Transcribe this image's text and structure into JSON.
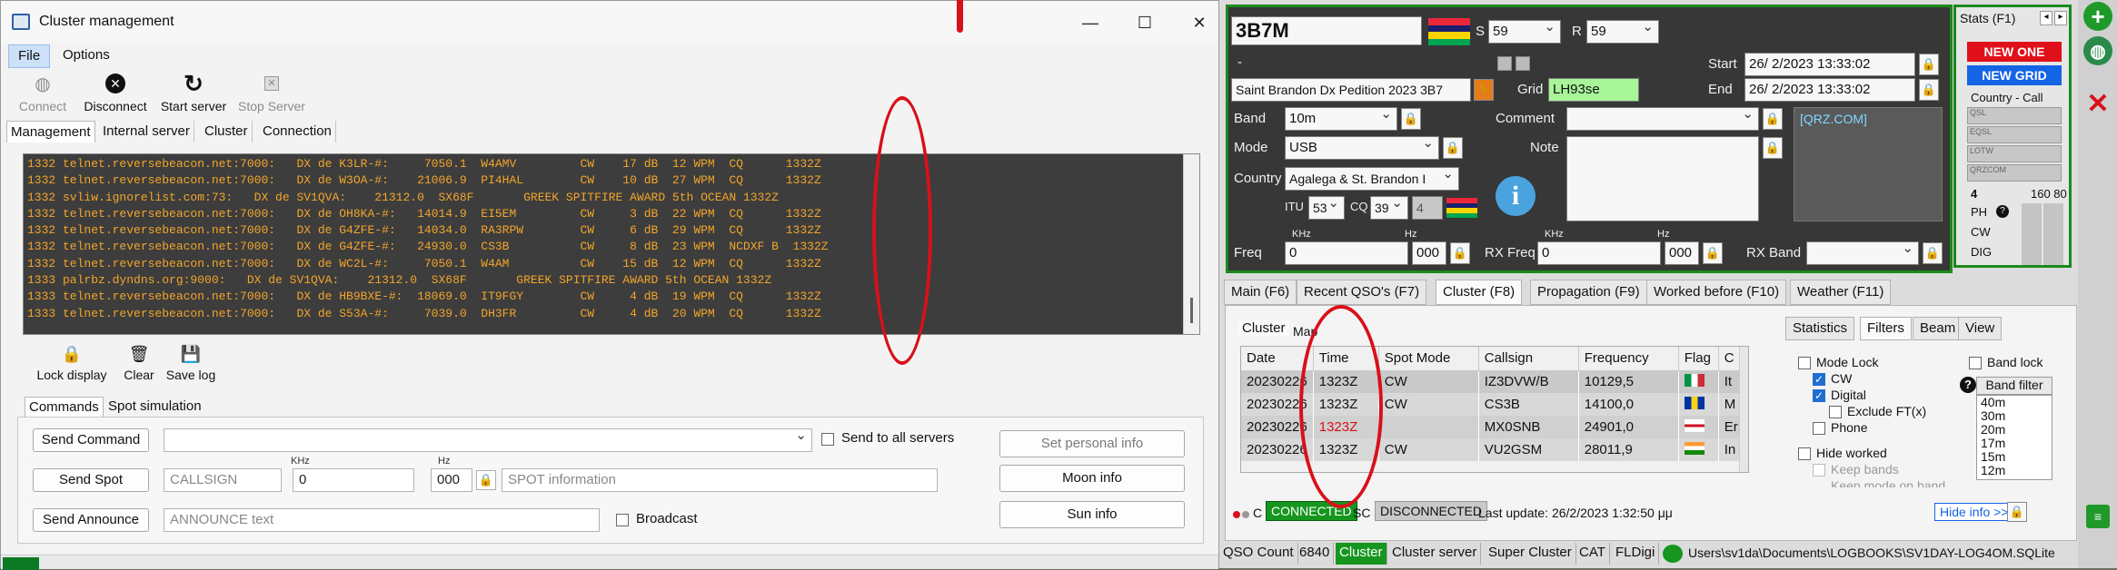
{
  "left_window": {
    "title": "Cluster management",
    "menu": [
      "File",
      "Options"
    ],
    "toolbar": {
      "connect": "Connect",
      "disconnect": "Disconnect",
      "start_server": "Start server",
      "stop_server": "Stop Server"
    },
    "tabs": [
      "Management",
      "Internal server",
      "Cluster",
      "Connection"
    ],
    "console_lines": [
      "1332 telnet.reversebeacon.net:7000:   DX de K3LR-#:     7050.1  W4AMV         CW    17 dB  12 WPM  CQ      1332Z",
      "1332 telnet.reversebeacon.net:7000:   DX de W3OA-#:    21006.9  PI4HAL        CW    10 dB  27 WPM  CQ      1332Z",
      "1332 svliw.ignorelist.com:73:   DX de SV1QVA:    21312.0  SX68F       GREEK SPITFIRE AWARD 5th OCEAN 1332Z",
      "1332 telnet.reversebeacon.net:7000:   DX de OH8KA-#:   14014.9  EI5EM         CW     3 dB  22 WPM  CQ      1332Z",
      "1332 telnet.reversebeacon.net:7000:   DX de G4ZFE-#:   14034.0  RA3RPW        CW     6 dB  29 WPM  CQ      1332Z",
      "1332 telnet.reversebeacon.net:7000:   DX de G4ZFE-#:   24930.0  CS3B          CW     8 dB  23 WPM  NCDXF B  1332Z",
      "1332 telnet.reversebeacon.net:7000:   DX de WC2L-#:     7050.1  W4AM          CW    15 dB  12 WPM  CQ      1332Z",
      "1333 palrbz.dyndns.org:9000:   DX de SV1QVA:    21312.0  SX68F       GREEK SPITFIRE AWARD 5th OCEAN 1332Z",
      "1333 telnet.reversebeacon.net:7000:   DX de HB9BXE-#:  18069.0  IT9FGY        CW     4 dB  19 WPM  CQ      1332Z",
      "1333 telnet.reversebeacon.net:7000:   DX de S53A-#:     7039.0  DH3FR         CW     4 dB  20 WPM  CQ      1332Z"
    ],
    "lower_toolbar": {
      "lock_display": "Lock display",
      "clear": "Clear",
      "save_log": "Save log"
    },
    "cmd_tabs": [
      "Commands",
      "Spot simulation"
    ],
    "commands": {
      "send_command": "Send Command",
      "send_to_all": "Send to all servers",
      "send_spot": "Send Spot",
      "callsign_placeholder": "CALLSIGN",
      "khz_label": "KHz",
      "khz_value": "0",
      "hz_label": "Hz",
      "hz_value": "000",
      "spot_info_placeholder": "SPOT information",
      "send_announce": "Send Announce",
      "announce_placeholder": "ANNOUNCE text",
      "broadcast": "Broadcast",
      "set_personal_info": "Set personal info",
      "moon_info": "Moon info",
      "sun_info": "Sun info"
    }
  },
  "right_window": {
    "callsign": "3B7M",
    "s_label": "S",
    "s_value": "59",
    "r_label": "R",
    "r_value": "59",
    "dash": "-",
    "start_label": "Start",
    "start_value": "26/  2/2023 13:33:02",
    "end_label": "End",
    "end_value": "26/  2/2023 13:33:02",
    "qth": "Saint Brandon Dx Pedition 2023 3B7",
    "grid_label": "Grid",
    "grid_value": "LH93se",
    "band_label": "Band",
    "band_value": "10m",
    "comment_label": "Comment",
    "mode_label": "Mode",
    "mode_value": "USB",
    "note_label": "Note",
    "qrz_link": "[QRZ.COM]",
    "country_label": "Country",
    "country_value": "Agalega & St. Brandon I",
    "itu_label": "ITU",
    "itu_value": "53",
    "cq_label": "CQ",
    "cq_value": "39",
    "extra_value": "4",
    "freq_label": "Freq",
    "freq_khz_label": "KHz",
    "freq_value": "0",
    "freq_hz_label": "Hz",
    "freq_hz_value": "000",
    "rxfreq_label": "RX Freq",
    "rxfreq_value": "0",
    "rxfreq_hz_value": "000",
    "rxband_label": "RX Band",
    "stats": {
      "title": "Stats (F1)",
      "new_one": "NEW ONE",
      "new_grid": "NEW GRID",
      "country_call": "Country - Call",
      "badges": [
        "QSL",
        "EQSL",
        "LOTW",
        "QRZCOM"
      ],
      "bands_header_left": "4",
      "bands_header_right": "160 80",
      "modes": [
        "PH",
        "CW",
        "DIG"
      ]
    },
    "main_tabs": [
      "Main (F6)",
      "Recent QSO's (F7)",
      "Cluster (F8)",
      "Propagation (F9)",
      "Worked before (F10)",
      "Weather (F11)"
    ],
    "subtabs": [
      "Cluster",
      "Map"
    ],
    "filter_tabs": [
      "Statistics",
      "Filters",
      "Beam",
      "View"
    ],
    "table_headers": [
      "Date",
      "Time",
      "Spot Mode",
      "Callsign",
      "Frequency",
      "Flag",
      "C"
    ],
    "rows": [
      {
        "date": "20230226",
        "time": "1323Z",
        "mode": "CW",
        "call": "IZ3DVW/B",
        "freq": "10129,5",
        "c": "It"
      },
      {
        "date": "20230226",
        "time": "1323Z",
        "mode": "CW",
        "call": "CS3B",
        "freq": "14100,0",
        "c": "M"
      },
      {
        "date": "20230226",
        "time": "1323Z",
        "mode": "",
        "call": "MX0SNB",
        "freq": "24901,0",
        "c": "Er"
      },
      {
        "date": "20230226",
        "time": "1323Z",
        "mode": "CW",
        "call": "VU2GSM",
        "freq": "28011,9",
        "c": "In"
      }
    ],
    "filters": {
      "mode_lock": "Mode Lock",
      "cw": "CW",
      "digital": "Digital",
      "exclude_ft": "Exclude FT(x)",
      "phone": "Phone",
      "hide_worked": "Hide worked",
      "keep_bands": "Keep bands",
      "keep_mode": "Keep mode on band",
      "band_lock": "Band lock",
      "band_filter": "Band filter",
      "bands": [
        "40m",
        "30m",
        "20m",
        "17m",
        "15m",
        "12m"
      ]
    },
    "status": {
      "c_label": "C",
      "connected": "CONNECTED",
      "sc_label": "SC",
      "disconnected": "DISCONNECTED",
      "last_update": "Last update: 26/2/2023 1:32:50 μμ",
      "hide_info": "Hide info >>"
    },
    "statusbar": {
      "qso_count_label": "QSO Count",
      "qso_count": "6840",
      "cluster": "Cluster",
      "cluster_server": "Cluster server",
      "super_cluster": "Super Cluster",
      "cat": "CAT",
      "fldigi": "FLDigi",
      "path": "Users\\sv1da\\Documents\\LOGBOOKS\\SV1DAY-LOG4OM.SQLite"
    }
  },
  "colors": {
    "console_bg": "#3d3d3d",
    "console_text": "#f2a52b",
    "annotation": "#d8101a",
    "panel_border": "#1b8a1b",
    "new_one": "#e0101a",
    "new_grid": "#1464e6"
  }
}
